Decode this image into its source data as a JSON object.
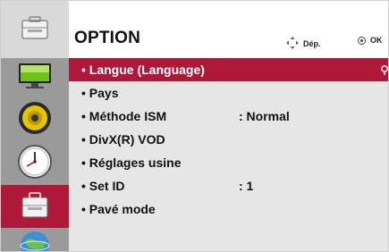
{
  "header": {
    "title": "OPTION",
    "move_hint": "Dép.",
    "ok_hint": "OK"
  },
  "sidebar": {
    "items": [
      {
        "icon": "option-toolbox-icon",
        "state": "header"
      },
      {
        "icon": "picture-monitor-icon"
      },
      {
        "icon": "audio-speaker-icon"
      },
      {
        "icon": "time-clock-icon"
      },
      {
        "icon": "option-toolbox-icon",
        "state": "selected"
      },
      {
        "icon": "network-globe-icon"
      }
    ]
  },
  "menu": {
    "items": [
      {
        "label": "• Langue (Language)",
        "value": "",
        "selected": true
      },
      {
        "label": "• Pays",
        "value": ""
      },
      {
        "label": "• Méthode ISM",
        "value": ": Normal"
      },
      {
        "label": "• DivX(R) VOD",
        "value": ""
      },
      {
        "label": "• Réglages usine",
        "value": ""
      },
      {
        "label": "• Set ID",
        "value": ": 1"
      },
      {
        "label": "• Pavé mode",
        "value": ""
      }
    ]
  },
  "colors": {
    "accent": "#b0183a",
    "sidebar_bg": "#9a9a9a",
    "panel_bg": "#e6e6e6"
  }
}
